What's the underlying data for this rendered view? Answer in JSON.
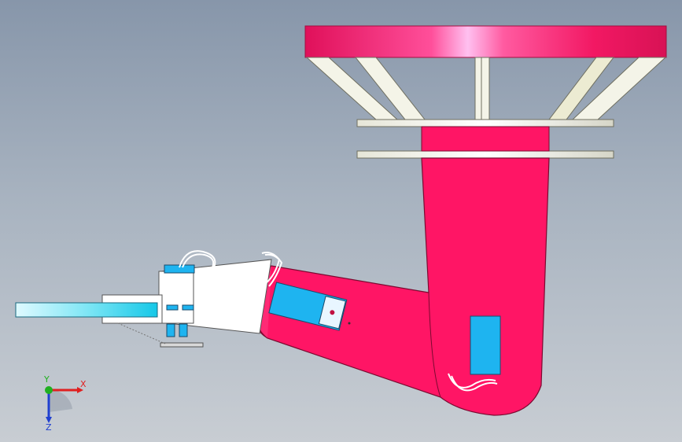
{
  "viewport": {
    "background_top": "#8796aa",
    "background_bottom": "#c8cdd3"
  },
  "model": {
    "base_plate_color": "#e8185a",
    "arm_color": "#ff1565",
    "forearm_color": "#ffffff",
    "gripper_color": "#33ccff",
    "servo_color": "#1eb4f0",
    "strut_color": "#f2f2e6",
    "ring_color": "#f0f0e8"
  },
  "triad": {
    "x_label": "X",
    "y_label": "Y",
    "z_label": "Z",
    "x_color": "#e02020",
    "y_color": "#20b020",
    "z_color": "#2040d0"
  }
}
